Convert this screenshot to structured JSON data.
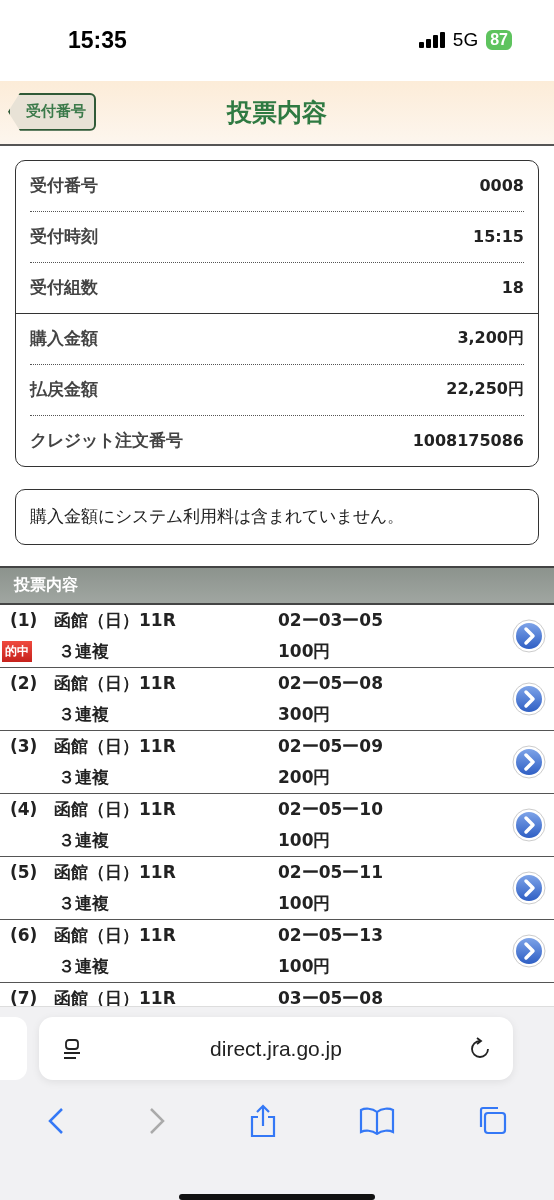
{
  "status_bar": {
    "time": "15:35",
    "network": "5G",
    "battery": "87"
  },
  "header": {
    "back_button": "受付番号",
    "title": "投票内容"
  },
  "info_groups": [
    [
      {
        "label": "受付番号",
        "value": "0008"
      },
      {
        "label": "受付時刻",
        "value": "15:15"
      },
      {
        "label": "受付組数",
        "value": "18"
      }
    ],
    [
      {
        "label": "購入金額",
        "value": "3,200円"
      },
      {
        "label": "払戻金額",
        "value": "22,250円"
      },
      {
        "label": "クレジット注文番号",
        "value": "1008175086"
      }
    ]
  ],
  "note": "購入金額にシステム利用料は含まれていません。",
  "bets_section": {
    "title": "投票内容",
    "rows": [
      {
        "number": "(1)",
        "race": "函館（日）11R",
        "type": "３連複",
        "combination": "02ー03ー05",
        "amount": "100円",
        "badge": "的中"
      },
      {
        "number": "(2)",
        "race": "函館（日）11R",
        "type": "３連複",
        "combination": "02ー05ー08",
        "amount": "300円"
      },
      {
        "number": "(3)",
        "race": "函館（日）11R",
        "type": "３連複",
        "combination": "02ー05ー09",
        "amount": "200円"
      },
      {
        "number": "(4)",
        "race": "函館（日）11R",
        "type": "３連複",
        "combination": "02ー05ー10",
        "amount": "100円"
      },
      {
        "number": "(5)",
        "race": "函館（日）11R",
        "type": "３連複",
        "combination": "02ー05ー11",
        "amount": "100円"
      },
      {
        "number": "(6)",
        "race": "函館（日）11R",
        "type": "３連複",
        "combination": "02ー05ー13",
        "amount": "100円"
      },
      {
        "number": "(7)",
        "race": "函館（日）11R",
        "combination": "03ー05ー08"
      }
    ]
  },
  "browser": {
    "url": "direct.jra.go.jp"
  }
}
